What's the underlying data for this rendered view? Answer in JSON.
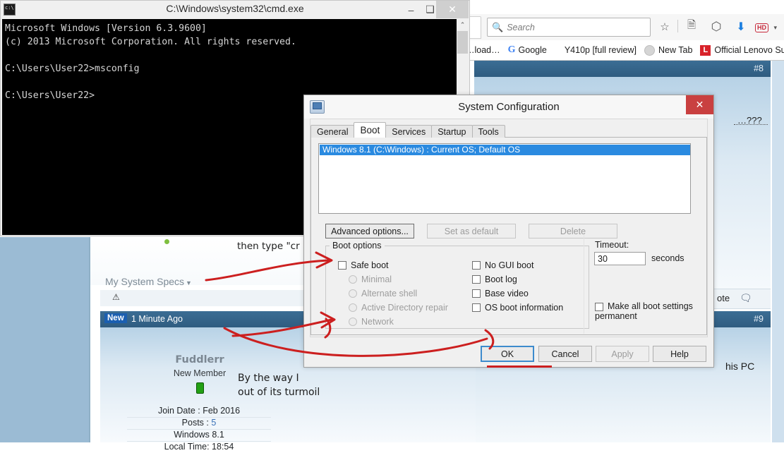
{
  "browser": {
    "search_placeholder": "Search",
    "icons": {
      "search": "search-icon",
      "bookmark_star": "star-icon",
      "reading_list": "reading-list-icon",
      "pocket": "pocket-icon",
      "downloads": "download-arrow-icon",
      "hd_badge": "HD",
      "hd_caret": "▾"
    },
    "bookmarks": [
      {
        "label": "…load…",
        "icon": ""
      },
      {
        "label": "Google",
        "icon": "google-g-icon"
      },
      {
        "label": "Y410p [full review]",
        "icon": ""
      },
      {
        "label": "New Tab",
        "icon": "globe-icon"
      },
      {
        "label": "Official Lenovo Suppo",
        "icon": "lenovo-l-icon"
      }
    ]
  },
  "forum": {
    "post8": {
      "number": "#8",
      "trailing_text": "…???"
    },
    "quote_bar": {
      "label": "ote",
      "icon": "quote-bubble-icon"
    },
    "post9": {
      "number": "#9",
      "text": "his PC"
    },
    "instruction_text": "then type \"cr",
    "my_system_specs": "My System Specs",
    "new_badge": "New",
    "new_time": "1 Minute Ago",
    "author": {
      "name": "Fuddlerr",
      "rank": "New Member",
      "join_date": "Join Date : Feb 2016",
      "posts_label": "Posts : ",
      "posts_value": "5",
      "os": "Windows 8.1",
      "local_time": "Local Time: 18:54"
    },
    "post_text_line1": "By the way I",
    "post_text_line2": "out of its turmoil"
  },
  "cmd": {
    "title": "C:\\Windows\\system32\\cmd.exe",
    "minimize": "–",
    "maximize": "❑",
    "close": "✕",
    "scroll_up": "⌃",
    "console_text": "Microsoft Windows [Version 6.3.9600]\n(c) 2013 Microsoft Corporation. All rights reserved.\n\nC:\\Users\\User22>msconfig\n\nC:\\Users\\User22>"
  },
  "sysconfig": {
    "title": "System Configuration",
    "close": "✕",
    "tabs": [
      {
        "label": "General",
        "active": false
      },
      {
        "label": "Boot",
        "active": true
      },
      {
        "label": "Services",
        "active": false
      },
      {
        "label": "Startup",
        "active": false
      },
      {
        "label": "Tools",
        "active": false
      }
    ],
    "os_entry": "Windows 8.1 (C:\\Windows) : Current OS; Default OS",
    "buttons": {
      "advanced": "Advanced options...",
      "set_default": "Set as default",
      "delete": "Delete",
      "ok": "OK",
      "cancel": "Cancel",
      "apply": "Apply",
      "help": "Help"
    },
    "boot_options": {
      "legend": "Boot options",
      "safe_boot": "Safe boot",
      "safe_boot_checked": false,
      "safe_modes": [
        "Minimal",
        "Alternate shell",
        "Active Directory repair",
        "Network"
      ],
      "right_checks": [
        "No GUI boot",
        "Boot log",
        "Base video",
        "OS boot information"
      ]
    },
    "timeout": {
      "label": "Timeout:",
      "value": "30",
      "unit": "seconds",
      "permanent": "Make all boot settings permanent"
    }
  },
  "colors": {
    "accent_blue": "#2a8ae0",
    "close_red": "#c94040",
    "annotation_red": "#cc1f1f",
    "forum_header": "#2f5c80",
    "page_blue": "#9bbbd4"
  }
}
